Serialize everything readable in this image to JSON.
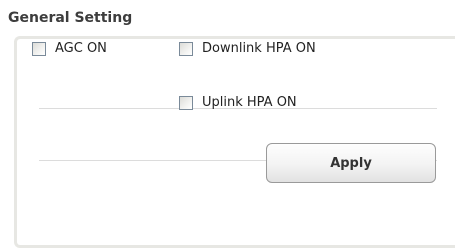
{
  "section": {
    "title": "General Setting"
  },
  "options": {
    "agc_on": {
      "label": "AGC ON",
      "checked": false
    },
    "downlink_hpa_on": {
      "label": "Downlink HPA ON",
      "checked": false
    },
    "uplink_hpa_on": {
      "label": "Uplink HPA ON",
      "checked": false
    }
  },
  "actions": {
    "apply_label": "Apply"
  },
  "colors": {
    "panel_border": "#e7e7e3",
    "title_text": "#3d3d3d"
  }
}
